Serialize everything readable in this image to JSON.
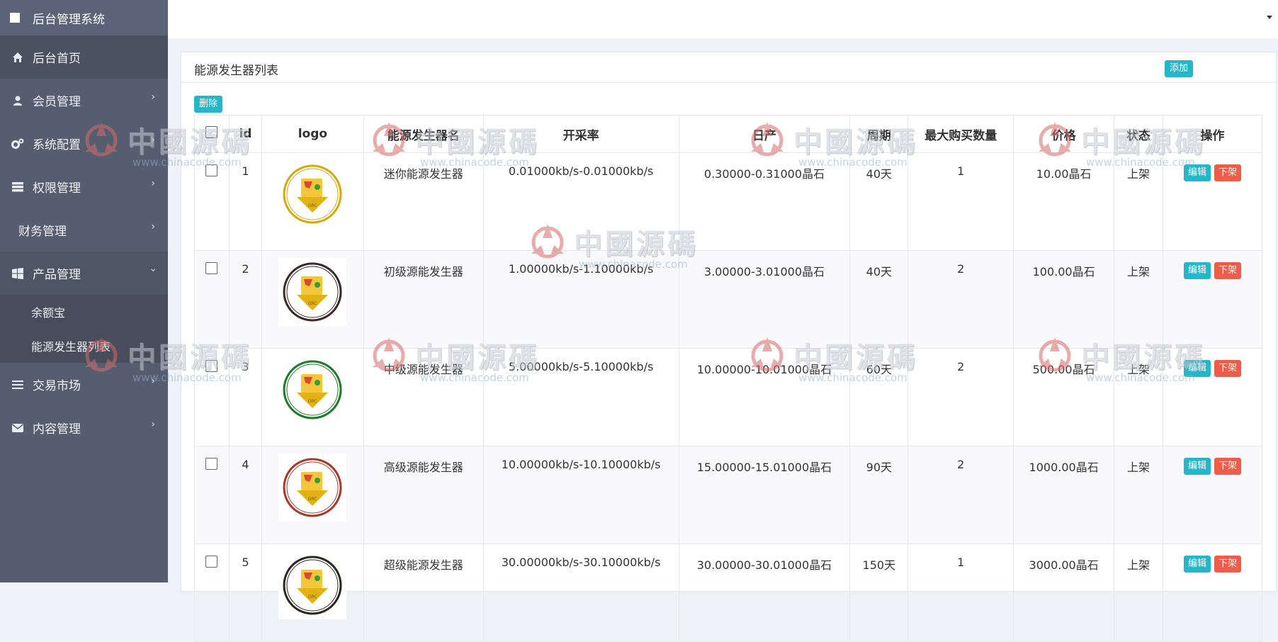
{
  "brand": {
    "title": "后台管理系统"
  },
  "sidebar": {
    "items": [
      {
        "label": "后台首页",
        "icon": "home-icon",
        "has_children": false
      },
      {
        "label": "会员管理",
        "icon": "user-icon",
        "has_children": true
      },
      {
        "label": "系统配置",
        "icon": "gears-icon",
        "has_children": true
      },
      {
        "label": "权限管理",
        "icon": "server-icon",
        "has_children": true
      },
      {
        "label": "财务管理",
        "icon": "",
        "has_children": true
      },
      {
        "label": "产品管理",
        "icon": "windows-icon",
        "has_children": true,
        "expanded": true
      },
      {
        "label": "交易市场",
        "icon": "list-icon",
        "has_children": true
      },
      {
        "label": "内容管理",
        "icon": "envelope-icon",
        "has_children": true
      }
    ],
    "product_sub": [
      "余额宝",
      "能源发生器列表"
    ]
  },
  "panel": {
    "title": "能源发生器列表",
    "add_label": "添加",
    "delete_label": "删除"
  },
  "table": {
    "headers": [
      "id",
      "logo",
      "能源发生器名",
      "开采率",
      "日产",
      "周期",
      "最大购买数量",
      "价格",
      "状态",
      "操作"
    ],
    "rows": [
      {
        "id": "1",
        "name": "迷你能源发生器",
        "rate": "0.01000kb/s-0.01000kb/s",
        "daily": "0.30000-0.31000晶石",
        "period": "40天",
        "max": "1",
        "price": "10.00晶石",
        "status": "上架",
        "ring": "#d4a90c"
      },
      {
        "id": "2",
        "name": "初级源能发生器",
        "rate": "1.00000kb/s-1.10000kb/s",
        "daily": "3.00000-3.01000晶石",
        "period": "40天",
        "max": "2",
        "price": "100.00晶石",
        "status": "上架",
        "ring": "#3a2a28"
      },
      {
        "id": "3",
        "name": "中级源能发生器",
        "rate": "5.00000kb/s-5.10000kb/s",
        "daily": "10.00000-10.01000晶石",
        "period": "60天",
        "max": "2",
        "price": "500.00晶石",
        "status": "上架",
        "ring": "#1f7a28"
      },
      {
        "id": "4",
        "name": "高级源能发生器",
        "rate": "10.00000kb/s-10.10000kb/s",
        "daily": "15.00000-15.01000晶石",
        "period": "90天",
        "max": "2",
        "price": "1000.00晶石",
        "status": "上架",
        "ring": "#a8382a"
      },
      {
        "id": "5",
        "name": "超级能源发生器",
        "rate": "30.00000kb/s-30.10000kb/s",
        "daily": "30.00000-30.01000晶石",
        "period": "150天",
        "max": "1",
        "price": "3000.00晶石",
        "status": "上架",
        "ring": "#2c2620"
      }
    ],
    "edit_label": "编辑",
    "offline_label": "下架"
  },
  "watermark": {
    "text": "中國源碼",
    "url": "www.chinacode.com"
  }
}
